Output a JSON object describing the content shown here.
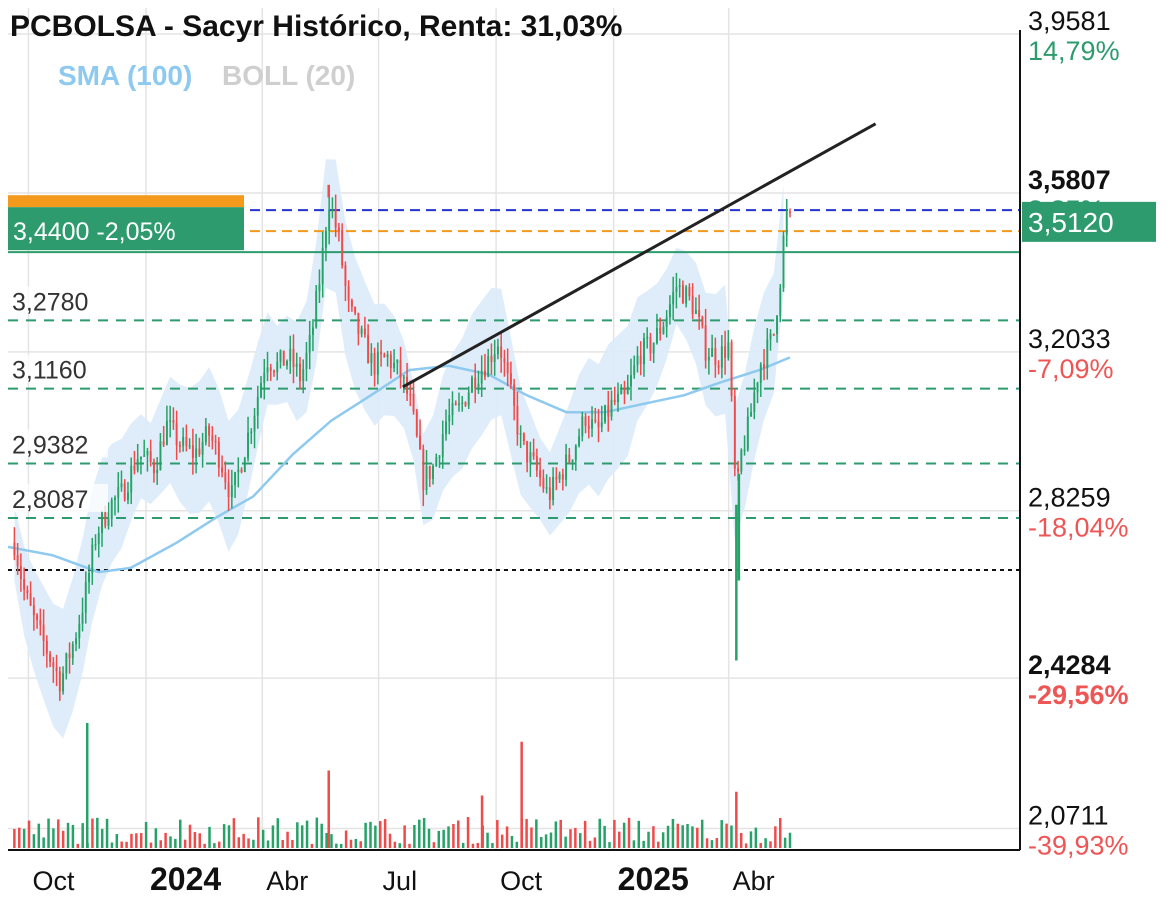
{
  "chart_data": {
    "type": "candlestick",
    "title": "PCBOLSA - Sacyr Histórico, Renta: 31,03%",
    "indicators": [
      {
        "label": "SMA (100)",
        "color": "#8ec9f0"
      },
      {
        "label": "BOLL (20)",
        "color": "#cfcfcf"
      }
    ],
    "x_ticks": [
      {
        "label": "Oct",
        "bold": false,
        "date": "2023-10-01"
      },
      {
        "label": "2024",
        "bold": true,
        "date": "2024-01-01"
      },
      {
        "label": "Abr",
        "bold": false,
        "date": "2024-04-01"
      },
      {
        "label": "Jul",
        "bold": false,
        "date": "2024-07-01"
      },
      {
        "label": "Oct",
        "bold": false,
        "date": "2024-10-01"
      },
      {
        "label": "2025",
        "bold": true,
        "date": "2025-01-01"
      },
      {
        "label": "Abr",
        "bold": false,
        "date": "2025-04-01"
      }
    ],
    "x_range": [
      "2023-09-15",
      "2025-11-15"
    ],
    "y_range": [
      2.02,
      4.02
    ],
    "y_axis_labels": [
      {
        "value": 3.9581,
        "text": "3,9581",
        "pct": "14,79%",
        "pct_color": "#2e9b6e",
        "bold": false
      },
      {
        "value": 3.5807,
        "text": "3,5807",
        "pct": "3,85%",
        "pct_color": "#2e9b6e",
        "bold": true
      },
      {
        "value": 3.2033,
        "text": "3,2033",
        "pct": "-7,09%",
        "pct_color": "#ee5555",
        "bold": false
      },
      {
        "value": 2.8259,
        "text": "2,8259",
        "pct": "-18,04%",
        "pct_color": "#ee5555",
        "bold": false
      },
      {
        "value": 2.4284,
        "text": "2,4284",
        "pct": "-29,56%",
        "pct_color": "#ee5555",
        "bold": true
      },
      {
        "value": 2.0711,
        "text": "2,0711",
        "pct": "-39,93%",
        "pct_color": "#ee5555",
        "bold": false
      }
    ],
    "current_price": {
      "value": 3.512,
      "text": "3,5120",
      "color": "#2e9b6e"
    },
    "reference_price": {
      "value": 3.44,
      "text": "3,4400",
      "change": "-2,05%",
      "color": "#2e9b6e"
    },
    "support_levels": [
      {
        "value": 3.278,
        "text": "3,2780"
      },
      {
        "value": 3.116,
        "text": "3,1160"
      },
      {
        "value": 2.9382,
        "text": "2,9382"
      },
      {
        "value": 2.8087,
        "text": "2,8087"
      }
    ],
    "blue_dashed_level": 3.54,
    "orange_dashed_level": 3.49,
    "black_dotted_level": 2.685,
    "trendline": {
      "start": [
        "2024-07-20",
        3.12
      ],
      "end": [
        "2025-07-25",
        3.745
      ],
      "color": "#222222"
    },
    "colors": {
      "up": "#26a269",
      "down": "#ee4b4b",
      "sma": "#8ec9f0",
      "band": "#dcebf9",
      "grid": "#e4e4e4"
    },
    "price_path": [
      [
        "2023-09-20",
        2.75
      ],
      [
        "2023-09-28",
        2.63
      ],
      [
        "2023-10-06",
        2.56
      ],
      [
        "2023-10-16",
        2.49
      ],
      [
        "2023-10-26",
        2.42
      ],
      [
        "2023-11-06",
        2.52
      ],
      [
        "2023-11-14",
        2.62
      ],
      [
        "2023-11-23",
        2.77
      ],
      [
        "2023-12-04",
        2.84
      ],
      [
        "2023-12-14",
        2.87
      ],
      [
        "2023-12-26",
        2.96
      ],
      [
        "2024-01-08",
        2.93
      ],
      [
        "2024-01-17",
        3.03
      ],
      [
        "2024-01-29",
        2.98
      ],
      [
        "2024-02-08",
        2.96
      ],
      [
        "2024-02-19",
        3.01
      ],
      [
        "2024-02-28",
        2.95
      ],
      [
        "2024-03-08",
        2.86
      ],
      [
        "2024-03-18",
        2.97
      ],
      [
        "2024-03-27",
        3.08
      ],
      [
        "2024-04-04",
        3.19
      ],
      [
        "2024-04-12",
        3.17
      ],
      [
        "2024-04-22",
        3.19
      ],
      [
        "2024-05-01",
        3.14
      ],
      [
        "2024-05-09",
        3.23
      ],
      [
        "2024-05-17",
        3.4
      ],
      [
        "2024-05-23",
        3.57
      ],
      [
        "2024-05-31",
        3.47
      ],
      [
        "2024-06-07",
        3.31
      ],
      [
        "2024-06-17",
        3.24
      ],
      [
        "2024-06-27",
        3.17
      ],
      [
        "2024-07-08",
        3.19
      ],
      [
        "2024-07-18",
        3.15
      ],
      [
        "2024-07-26",
        3.08
      ],
      [
        "2024-08-05",
        2.9
      ],
      [
        "2024-08-13",
        2.93
      ],
      [
        "2024-08-23",
        3.04
      ],
      [
        "2024-09-03",
        3.07
      ],
      [
        "2024-09-13",
        3.14
      ],
      [
        "2024-09-24",
        3.18
      ],
      [
        "2024-10-03",
        3.23
      ],
      [
        "2024-10-11",
        3.12
      ],
      [
        "2024-10-21",
        2.98
      ],
      [
        "2024-10-31",
        2.93
      ],
      [
        "2024-11-11",
        2.86
      ],
      [
        "2024-11-20",
        2.91
      ],
      [
        "2024-11-29",
        2.96
      ],
      [
        "2024-12-10",
        3.05
      ],
      [
        "2024-12-19",
        3.01
      ],
      [
        "2024-12-31",
        3.08
      ],
      [
        "2025-01-10",
        3.09
      ],
      [
        "2025-01-21",
        3.2
      ],
      [
        "2025-01-31",
        3.22
      ],
      [
        "2025-02-10",
        3.28
      ],
      [
        "2025-02-19",
        3.36
      ],
      [
        "2025-02-26",
        3.34
      ],
      [
        "2025-03-05",
        3.31
      ],
      [
        "2025-03-14",
        3.21
      ],
      [
        "2025-03-24",
        3.19
      ],
      [
        "2025-04-01",
        3.22
      ],
      [
        "2025-04-07",
        2.84
      ],
      [
        "2025-04-10",
        2.95
      ],
      [
        "2025-04-16",
        3.02
      ],
      [
        "2025-04-25",
        3.17
      ],
      [
        "2025-05-06",
        3.24
      ],
      [
        "2025-05-13",
        3.42
      ],
      [
        "2025-05-15",
        3.53
      ],
      [
        "2025-05-19",
        3.512
      ]
    ],
    "spikes": [
      {
        "date": "2025-04-07",
        "low": 2.47
      },
      {
        "date": "2025-04-09",
        "low": 2.66
      },
      {
        "date": "2024-05-23",
        "high": 3.6
      }
    ],
    "sma_path": [
      [
        "2023-09-15",
        2.74
      ],
      [
        "2023-10-20",
        2.72
      ],
      [
        "2023-11-25",
        2.68
      ],
      [
        "2023-12-20",
        2.69
      ],
      [
        "2024-01-25",
        2.75
      ],
      [
        "2024-02-25",
        2.81
      ],
      [
        "2024-03-25",
        2.86
      ],
      [
        "2024-04-25",
        2.96
      ],
      [
        "2024-05-25",
        3.04
      ],
      [
        "2024-06-25",
        3.1
      ],
      [
        "2024-07-25",
        3.16
      ],
      [
        "2024-08-25",
        3.17
      ],
      [
        "2024-09-25",
        3.15
      ],
      [
        "2024-10-25",
        3.1
      ],
      [
        "2024-11-25",
        3.06
      ],
      [
        "2024-12-25",
        3.06
      ],
      [
        "2025-01-25",
        3.08
      ],
      [
        "2025-02-25",
        3.1
      ],
      [
        "2025-03-25",
        3.13
      ],
      [
        "2025-04-25",
        3.16
      ],
      [
        "2025-05-19",
        3.19
      ]
    ],
    "volume_bars": 160,
    "volume_spikes": [
      {
        "date": "2023-11-16",
        "value": 1.0
      },
      {
        "date": "2024-05-23",
        "value": 0.62
      },
      {
        "date": "2024-09-20",
        "value": 0.42
      },
      {
        "date": "2024-10-21",
        "value": 0.85
      },
      {
        "date": "2025-04-07",
        "value": 0.45
      }
    ]
  }
}
